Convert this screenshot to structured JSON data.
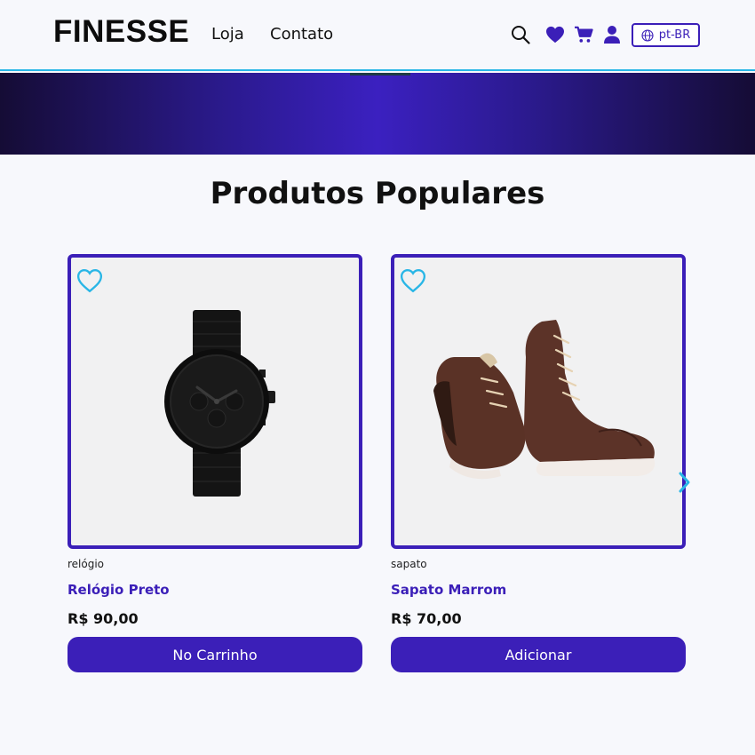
{
  "brand": {
    "logo": "FINESSE"
  },
  "nav": {
    "items": [
      {
        "label": "Loja"
      },
      {
        "label": "Contato"
      }
    ]
  },
  "header_icons": [
    "search-icon",
    "heart-icon",
    "cart-icon",
    "user-icon"
  ],
  "language": {
    "label": "pt-BR"
  },
  "section": {
    "title": "Produtos Populares"
  },
  "products": [
    {
      "category": "relógio",
      "name": "Relógio Preto",
      "price": "R$ 90,00",
      "button": "No Carrinho",
      "image": "watch-image"
    },
    {
      "category": "sapato",
      "name": "Sapato Marrom",
      "price": "R$ 70,00",
      "button": "Adicionar",
      "image": "boots-image"
    }
  ],
  "colors": {
    "accent": "#3b1fb8",
    "header_line": "#29b6e6",
    "favorite_icon": "#29b6e6"
  }
}
